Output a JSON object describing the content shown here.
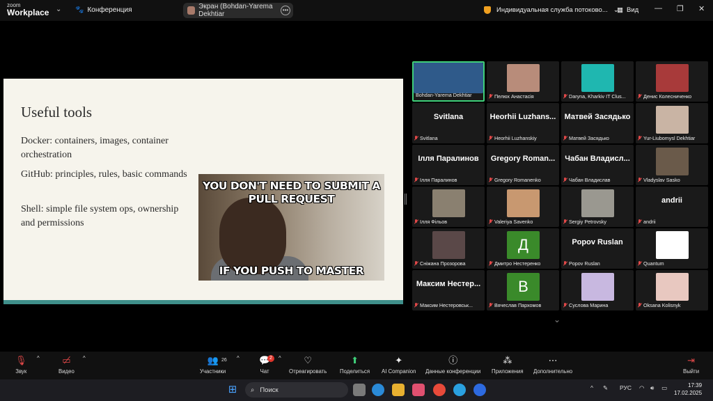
{
  "app": {
    "brand_small": "zoom",
    "brand": "Workplace"
  },
  "top_bar": {
    "conference_label": "Конференция",
    "screen_share_label": "Экран (Bohdan-Yarema Dekhtiar",
    "service_label": "Индивидуальная служба потоково...",
    "view_label": "Вид"
  },
  "slide": {
    "title": "Useful tools",
    "items": [
      "Docker: containers, images, container orchestration",
      "GitHub: principles, rules, basic commands",
      "Shell: simple file system ops, ownership and permissions"
    ],
    "meme_top": "YOU DON'T NEED TO SUBMIT A PULL REQUEST",
    "meme_bottom": "IF YOU PUSH TO MASTER"
  },
  "participants_grid": [
    {
      "name": "Bohdan-Yarema Dekhtiar",
      "kind": "photo",
      "color": "#2f5a8a",
      "active": true,
      "muted": false
    },
    {
      "name": "Пелюх Анастасія",
      "kind": "photo",
      "color": "#b88c7a",
      "muted": true
    },
    {
      "name": "Daryna, Kharkiv IT Clus...",
      "kind": "photo",
      "color": "#1fb7b0",
      "muted": true
    },
    {
      "name": "Денис Колесниченко",
      "kind": "photo",
      "color": "#a83a3a",
      "muted": true
    },
    {
      "name": "Svitlana",
      "kind": "text",
      "big": "Svitlana",
      "muted": true
    },
    {
      "name": "Heorhii Luzhanskiy",
      "kind": "text",
      "big": "Heorhii Luzhans...",
      "muted": true
    },
    {
      "name": "Матвей Засядько",
      "kind": "text",
      "big": "Матвей Засядько",
      "muted": true
    },
    {
      "name": "Yur-Liubomysl Dekhtiar",
      "kind": "photo",
      "color": "#c9b4a4",
      "muted": true
    },
    {
      "name": "Ілля Паралинов",
      "kind": "text",
      "big": "Ілля Паралинов",
      "muted": true
    },
    {
      "name": "Gregory Romanenko",
      "kind": "text",
      "big": "Gregory Roman...",
      "muted": true
    },
    {
      "name": "Чабан Владислав",
      "kind": "text",
      "big": "Чабан Владисл...",
      "muted": true
    },
    {
      "name": "Vladyslav Sasko",
      "kind": "photo",
      "color": "#6a5a4a",
      "muted": true
    },
    {
      "name": "Ілля Фільов",
      "kind": "photo",
      "color": "#8a8070",
      "muted": true
    },
    {
      "name": "Valeriya Savenko",
      "kind": "photo",
      "color": "#c89870",
      "muted": true
    },
    {
      "name": "Sergiy Petrovsky",
      "kind": "photo",
      "color": "#9a9890",
      "muted": true
    },
    {
      "name": "andrii",
      "kind": "text",
      "big": "andrii",
      "muted": true
    },
    {
      "name": "Сніжана Прозорова",
      "kind": "photo",
      "color": "#5a4848",
      "muted": true
    },
    {
      "name": "Дмитро Нестеренко",
      "kind": "letter",
      "letter": "Д",
      "color": "#3a8a2a",
      "muted": true
    },
    {
      "name": "Popov Ruslan",
      "kind": "text",
      "big": "Popov Ruslan",
      "muted": true
    },
    {
      "name": "Quantum",
      "kind": "photo",
      "color": "#ffffff",
      "muted": true
    },
    {
      "name": "Максим Нестеровськ...",
      "kind": "text",
      "big": "Максим Нестер...",
      "muted": true
    },
    {
      "name": "Вячеслав Пархомов",
      "kind": "letter",
      "letter": "В",
      "color": "#3a8a2a",
      "muted": true
    },
    {
      "name": "Суслова Марина",
      "kind": "photo",
      "color": "#c8b8e0",
      "muted": true
    },
    {
      "name": "Oksana Kolisnyk",
      "kind": "photo",
      "color": "#e8c8c0",
      "muted": true
    }
  ],
  "toolbar": {
    "audio": "Звук",
    "video": "Видео",
    "participants": "Участники",
    "participants_count": "26",
    "chat": "Чат",
    "chat_badge": "2",
    "react": "Отреагировать",
    "share": "Поделиться",
    "ai": "AI Companion",
    "info": "Данные конференции",
    "apps": "Приложения",
    "more": "Дополнительно",
    "leave": "Выйти"
  },
  "taskbar": {
    "search": "Поиск",
    "lang": "РУС",
    "time": "17:39",
    "date": "17.02.2025"
  }
}
